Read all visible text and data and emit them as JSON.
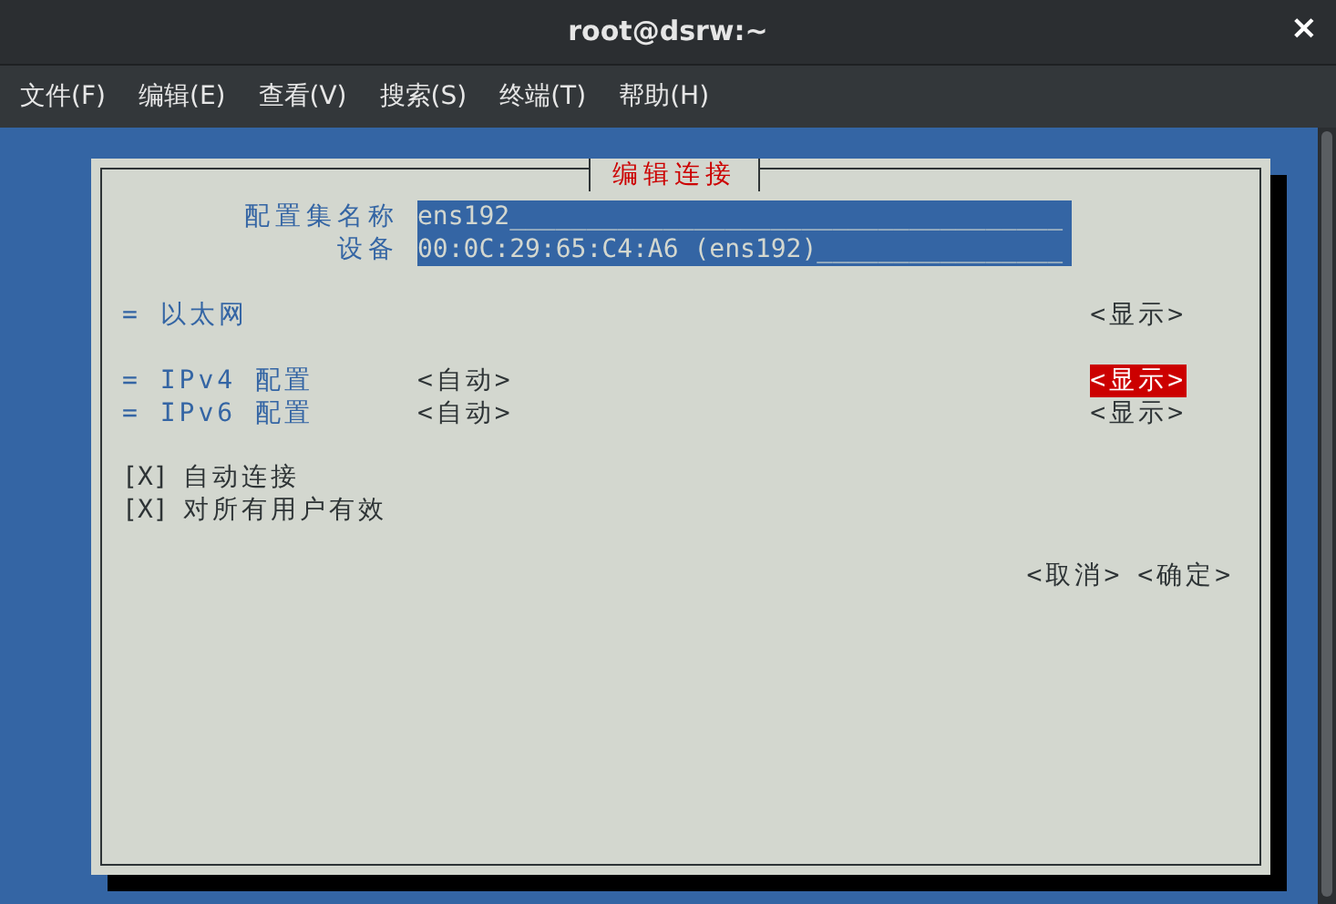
{
  "window": {
    "title": "root@dsrw:~",
    "close": "×"
  },
  "menu": [
    "文件(F)",
    "编辑(E)",
    "查看(V)",
    "搜索(S)",
    "终端(T)",
    "帮助(H)"
  ],
  "dialog": {
    "title": "编辑连接",
    "fields": [
      {
        "label": "配置集名称",
        "value": "ens192____________________________________"
      },
      {
        "label": "设备",
        "value": "00:0C:29:65:C4:A6 (ens192)________________"
      }
    ],
    "section_groups": [
      {
        "rows": [
          {
            "marker": "=",
            "label": "以太网",
            "toggle": "<显示>",
            "selected": false
          }
        ]
      },
      {
        "rows": [
          {
            "marker": "=",
            "label": "IPv4 配置",
            "value": "<自动>",
            "toggle": "<显示>",
            "selected": true
          },
          {
            "marker": "=",
            "label": "IPv6 配置",
            "value": "<自动>",
            "toggle": "<显示>",
            "selected": false
          }
        ]
      }
    ],
    "checkboxes": [
      {
        "box": "[X]",
        "label": "自动连接",
        "checked": true
      },
      {
        "box": "[X]",
        "label": "对所有用户有效",
        "checked": true
      }
    ],
    "buttons": [
      "<取消>",
      "<确定>"
    ]
  }
}
